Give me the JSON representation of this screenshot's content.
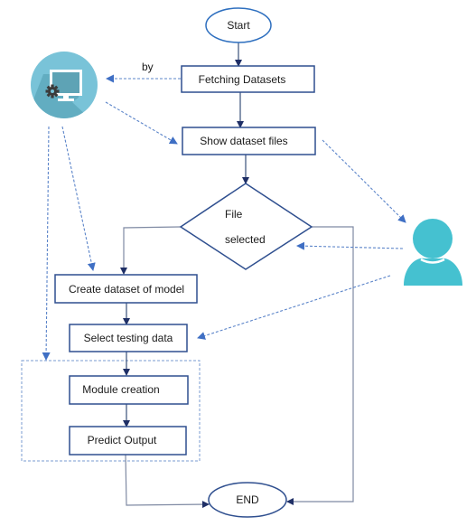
{
  "diagram": {
    "nodes": {
      "start": "Start",
      "fetch": "Fetching Datasets",
      "show": "Show dataset files",
      "decision_line1": "File",
      "decision_line2": "selected",
      "create": "Create dataset of model",
      "select": "Select testing data",
      "module": "Module creation",
      "predict": "Predict Output",
      "end": "END"
    },
    "labels": {
      "by": "by"
    },
    "actors": {
      "system": "system-computer-icon",
      "user": "user-person-icon"
    },
    "colors": {
      "node_border": "#2f4f8f",
      "start_border": "#2e6fbf",
      "dashed_arrow": "#5b84c9",
      "computer_circle": "#79c3d8",
      "user_fill": "#45c1d0"
    }
  }
}
